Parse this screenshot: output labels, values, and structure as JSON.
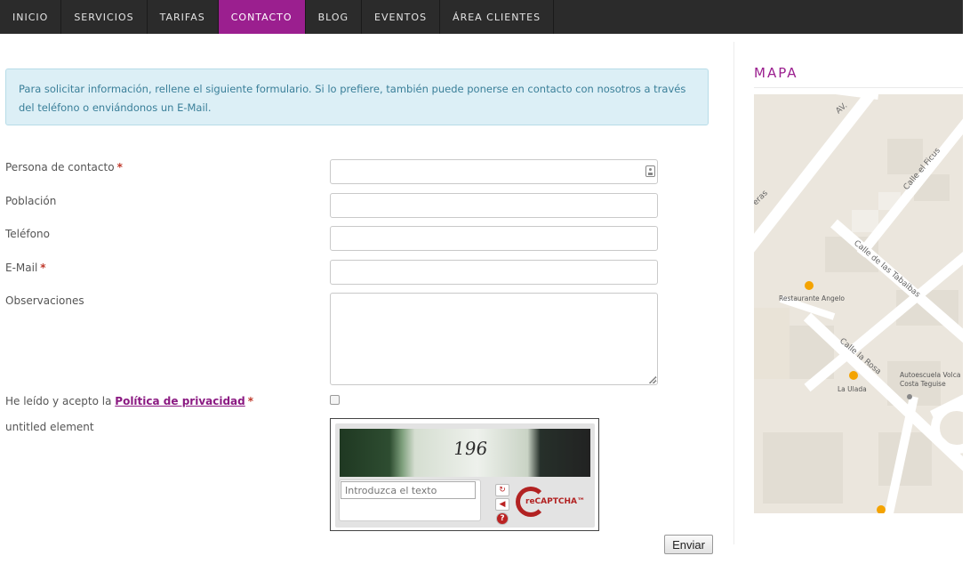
{
  "nav": {
    "items": [
      {
        "label": "INICIO"
      },
      {
        "label": "SERVICIOS"
      },
      {
        "label": "TARIFAS"
      },
      {
        "label": "CONTACTO",
        "active": true
      },
      {
        "label": "BLOG"
      },
      {
        "label": "EVENTOS"
      },
      {
        "label": "ÁREA CLIENTES"
      }
    ],
    "active_color": "#9b1f8f"
  },
  "info": {
    "text": "Para solicitar información, rellene el siguiente formulario. Si lo prefiere, también puede ponerse en contacto con nosotros a través del teléfono o enviándonos un E-Mail."
  },
  "form": {
    "contact_person_label": "Persona de contacto",
    "city_label": "Población",
    "phone_label": "Teléfono",
    "email_label": "E-Mail",
    "notes_label": "Observaciones",
    "privacy_prefix": "He leído y acepto la ",
    "privacy_link": "Política de privacidad",
    "required_marker": "*",
    "untitled_label": "untitled element",
    "submit_label": "Enviar",
    "privacy_checked": false
  },
  "captcha": {
    "challenge_text": "196",
    "input_placeholder": "Introduzca el texto",
    "logo_text": "reCAPTCHA™",
    "refresh_icon": "refresh-icon",
    "audio_icon": "audio-icon",
    "help_icon": "help-icon"
  },
  "sidebar": {
    "map_title": "MAPA",
    "map_labels": {
      "av": "AV.",
      "street1": "Calle el Ficus",
      "street2": "Calle de las Tabaibas",
      "street3": "Calle la Rosa",
      "street4": "eras",
      "poi1": "Restaurante Angelo",
      "poi2": "La Ulada",
      "poi3_line1": "Autoescuela Volca",
      "poi3_line2": "Costa Teguise"
    }
  }
}
